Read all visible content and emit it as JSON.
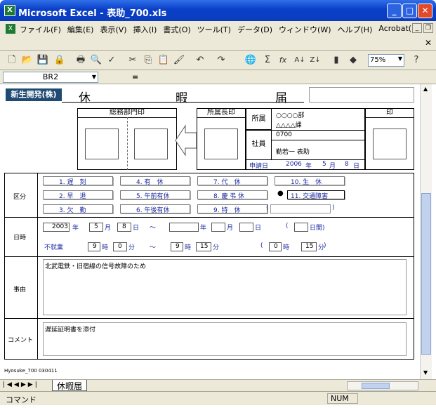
{
  "window": {
    "title": "Microsoft Excel - 表助_700.xls"
  },
  "menu": [
    "ファイル(F)",
    "編集(E)",
    "表示(V)",
    "挿入(I)",
    "書式(O)",
    "ツール(T)",
    "データ(D)",
    "ウィンドウ(W)",
    "ヘルプ(H)",
    "Acrobat(B)"
  ],
  "toolbar": {
    "zoom": "75%"
  },
  "formula": {
    "namebox": "BR2",
    "equals": "="
  },
  "form": {
    "company": "新生開発(株)",
    "title_chars": [
      "休",
      "暇",
      "届"
    ],
    "stamp_general": "総務部門印",
    "stamp_dept_head": "所属長印",
    "stamp_seal": "印",
    "dept_label": "所属",
    "dept_values": [
      "○○○○部",
      "△△△△課"
    ],
    "employee_label": "社員",
    "employee_no": "0700",
    "employee_name": "勤若一 表助",
    "request_label": "申請日",
    "request_year": "2006",
    "request_month": "5",
    "request_day": "8",
    "ymd": [
      "年",
      "月",
      "日"
    ],
    "category_label": "区分",
    "categories": [
      "1. 遅　刻",
      "2. 早　退",
      "3. 欠　勤",
      "4. 有　休",
      "5. 午前有休",
      "6. 午後有休",
      "7. 代　休",
      "8. 慶 弔 休",
      "9. 特　休",
      "10. 生　休",
      "11. 交通障害"
    ],
    "selected_mark": "●",
    "special_open": "(",
    "special_close": ")",
    "datetime_label": "日時",
    "date_year": "2003",
    "date_month": "5",
    "date_day": "8",
    "tilde": "～",
    "days_open": "(",
    "days_unit": "日間)",
    "nowork_label": "不就業",
    "from_hour": "9",
    "from_min": "0",
    "to_hour": "9",
    "to_min": "15",
    "hour_unit": "時",
    "min_unit": "分",
    "dur_open": "(",
    "dur_hour": "0",
    "dur_min": "15",
    "reason_label": "事由",
    "reason": "北武電鉄・旧宿線の信号故障のため",
    "comment_label": "コメント",
    "comment": "遅延証明書を添付",
    "footer_code": "Hyosuke_700 030411"
  },
  "sheet_tab": "休暇届",
  "status": {
    "mode": "コマンド",
    "num": "NUM"
  }
}
